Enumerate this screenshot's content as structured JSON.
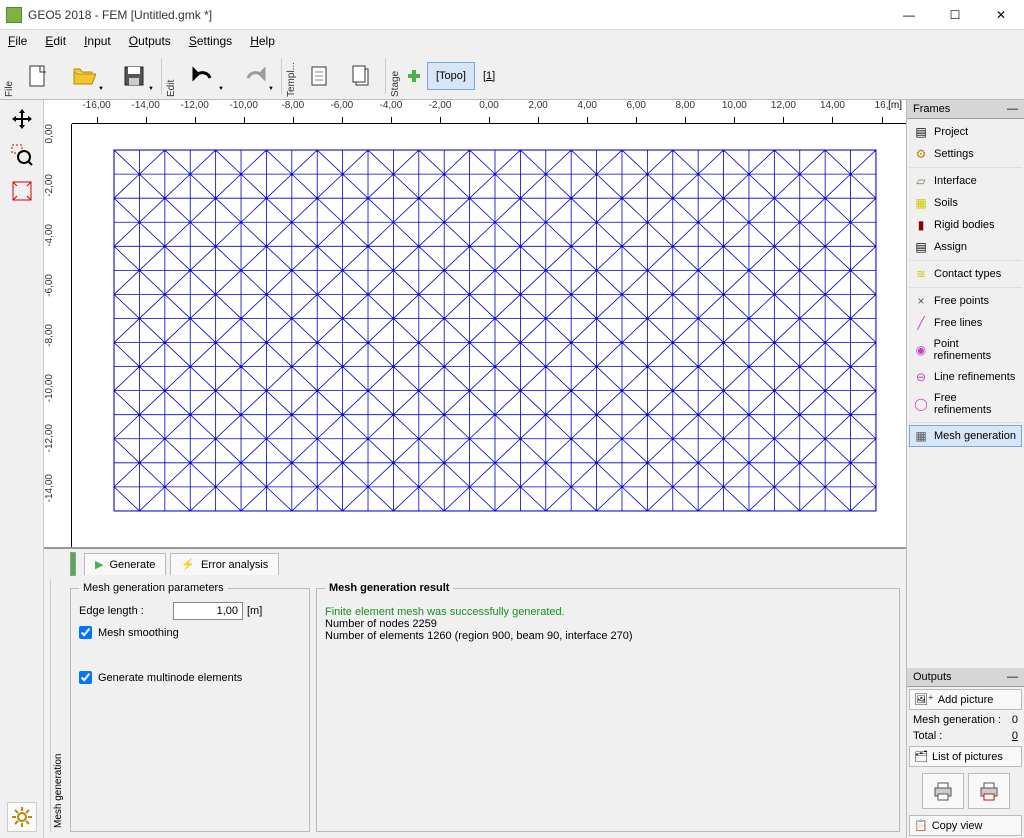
{
  "window": {
    "title": "GEO5 2018 - FEM [Untitled.gmk *]"
  },
  "menu": {
    "file": "File",
    "edit": "Edit",
    "input": "Input",
    "outputs": "Outputs",
    "settings": "Settings",
    "help": "Help"
  },
  "toolbar": {
    "file_label": "File",
    "edit_label": "Edit",
    "templ_label": "Templ...",
    "stage_label": "Stage",
    "topo": "[Topo]",
    "stage1": "[1]"
  },
  "ruler_h": [
    "-16,00",
    "-14,00",
    "-12,00",
    "-10,00",
    "-8,00",
    "-6,00",
    "-4,00",
    "-2,00",
    "0,00",
    "2,00",
    "4,00",
    "6,00",
    "8,00",
    "10,00",
    "12,00",
    "14,00",
    "16,"
  ],
  "ruler_h_unit": "[m]",
  "ruler_v": [
    "0,00",
    "-2,00",
    "-4,00",
    "-6,00",
    "-8,00",
    "-10,00",
    "-12,00",
    "-14,00"
  ],
  "frames": {
    "header": "Frames",
    "items": [
      "Project",
      "Settings",
      "Interface",
      "Soils",
      "Rigid bodies",
      "Assign",
      "Contact types",
      "Free points",
      "Free lines",
      "Point refinements",
      "Line refinements",
      "Free refinements",
      "Mesh generation"
    ]
  },
  "bottom": {
    "side_label": "Mesh generation",
    "tab_generate": "Generate",
    "tab_error": "Error analysis",
    "params_legend": "Mesh generation parameters",
    "edge_label": "Edge length :",
    "edge_value": "1,00",
    "edge_unit": "[m]",
    "smoothing": "Mesh smoothing",
    "multinode": "Generate multinode elements",
    "result_legend": "Mesh generation result",
    "result_success": "Finite element mesh was successfully generated.",
    "result_nodes": "Number of nodes 2259",
    "result_elems": "Number of elements 1260 (region 900, beam 90, interface 270)"
  },
  "outputs": {
    "header": "Outputs",
    "add_picture": "Add picture",
    "mg_label": "Mesh generation :",
    "mg_count": "0",
    "total_label": "Total :",
    "total_count": "0",
    "list": "List of pictures",
    "copy_view": "Copy view"
  }
}
